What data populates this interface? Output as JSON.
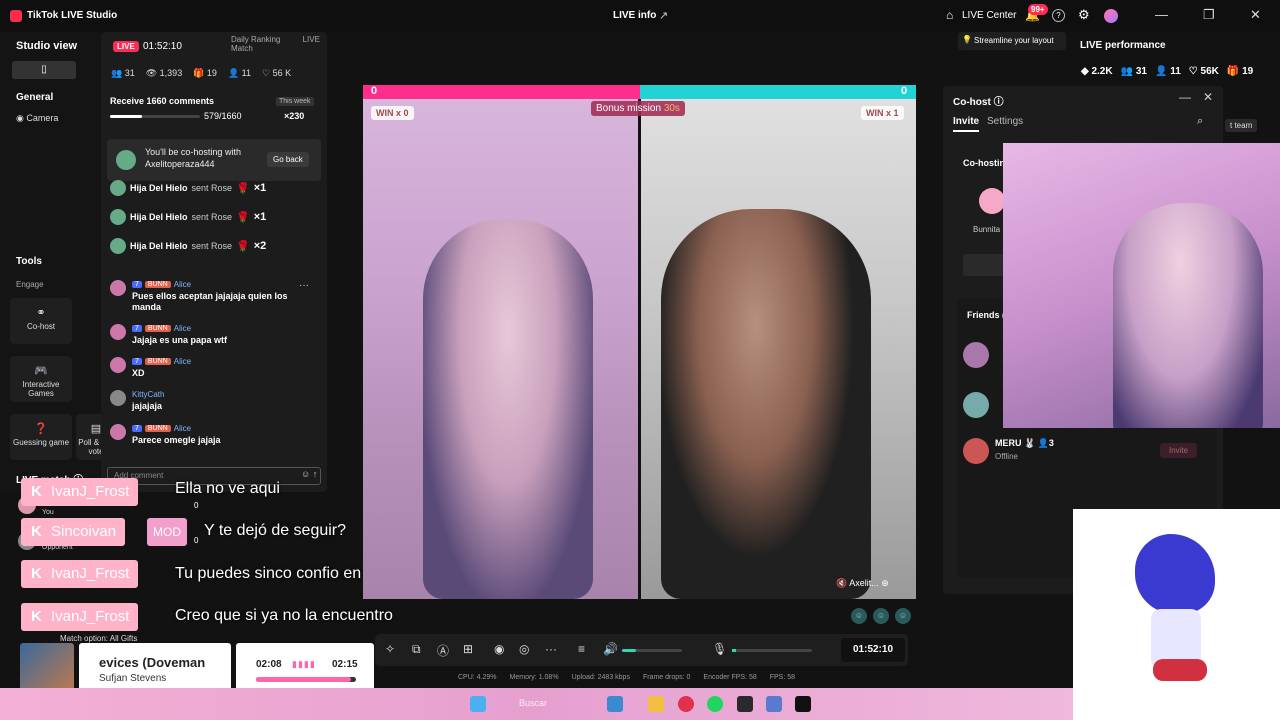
{
  "titlebar": {
    "app_title": "TikTok LIVE Studio",
    "center_title": "LIVE info",
    "live_center": "LIVE Center",
    "notif_badge": "99+"
  },
  "left": {
    "studio_view": "Studio view",
    "general": "General",
    "camera": "Camera",
    "tools": "Tools",
    "engage": "Engage",
    "tools_items": [
      "Co-host",
      "Interactive Games",
      "Guessing game",
      "Poll & Gift vote"
    ]
  },
  "comments": {
    "live_label": "LIVE",
    "timer": "01:52:10",
    "daily_ranking": "Daily Ranking",
    "live_match_tab": "LIVE Match",
    "stats": [
      "31",
      "1,393",
      "19",
      "11",
      "56 K"
    ],
    "receive_title": "Receive 1660 comments",
    "this_week": "This week",
    "progress_text": "579/1660",
    "progress_fraction": 0.35,
    "gift_mult": "×230",
    "cohost_notice": "You'll be co-hosting with Axelitoperaza444",
    "go_back": "Go back",
    "gifts": [
      {
        "user": "Hija Del Hielo",
        "text": "sent Rose",
        "mult": "×1"
      },
      {
        "user": "Hija Del Hielo",
        "text": "sent Rose",
        "mult": "×1"
      },
      {
        "user": "Hija Del Hielo",
        "text": "sent Rose",
        "mult": "×2"
      }
    ],
    "messages": [
      {
        "level": "7",
        "fan": "BUNN",
        "user": "Alice",
        "text": "Pues ellos aceptan jajajaja quien los manda"
      },
      {
        "level": "7",
        "fan": "BUNN",
        "user": "Alice",
        "text": "Jajaja es una papa wtf"
      },
      {
        "level": "7",
        "fan": "BUNN",
        "user": "Alice",
        "text": "XD"
      },
      {
        "level": "",
        "fan": "",
        "user": "KittyCath",
        "text": "jajajaja"
      },
      {
        "level": "7",
        "fan": "BUNN",
        "user": "Alice",
        "text": "Parece omegle jajaja"
      }
    ],
    "add_comment_placeholder": "Add comment"
  },
  "live_match": {
    "title": "LIVE match",
    "you_label": "You",
    "opponent_label": "Opponent",
    "you_score": "0",
    "opp_score": "0",
    "match_option": "Match option: All Gifts"
  },
  "overlay_chat": [
    {
      "user": "IvanJ_Frost",
      "text": "Ella no ve aqui"
    },
    {
      "user": "Sincoivan",
      "mod": "MOD",
      "text": "Y te dejó de seguir?"
    },
    {
      "user": "IvanJ_Frost",
      "text": "Tu puedes sinco confio en"
    },
    {
      "user": "IvanJ_Frost",
      "text": "Creo que si ya no la encuentro"
    }
  ],
  "match": {
    "left_score": "0",
    "right_score": "0",
    "left_win": "WIN x 0",
    "right_win": "WIN x 1",
    "bonus_label": "Bonus mission",
    "bonus_time": "30s",
    "guest_name": "Axelit..."
  },
  "controls": {
    "time": "01:52:10",
    "volume_level": 0.23,
    "mic_level": 0.05,
    "metrics": [
      "CPU: 4.29%",
      "Memory: 1.08%",
      "Upload: 2483 kbps",
      "Frame drops: 0",
      "Encoder FPS: 58",
      "FPS: 58"
    ]
  },
  "music": {
    "song": "evices (Doveman",
    "artist": "Sufjan Stevens",
    "current": "02:08",
    "total": "02:15",
    "progress": 0.95
  },
  "right": {
    "streamline": "Streamline your layout",
    "performance_title": "LIVE performance",
    "perf_stats": [
      "2.2K",
      "31",
      "11",
      "56K",
      "19"
    ],
    "cohost_title": "Co-host",
    "tab_invite": "Invite",
    "tab_settings": "Settings",
    "team_btn": "t team",
    "cohost_sub": "Co-hostin",
    "bunni_label": "Bunnita",
    "friends_label": "Friends (",
    "meru_name": "MERU",
    "meru_count": "3",
    "meru_status": "Offline",
    "invite_btn": "Invite"
  },
  "taskbar": {
    "search_text": "Buscar"
  },
  "colors": {
    "accent": "#fe2c55",
    "score_left": "#ff2d8b",
    "score_right": "#22d3d6",
    "tag_pink": "#ffb3c8"
  }
}
